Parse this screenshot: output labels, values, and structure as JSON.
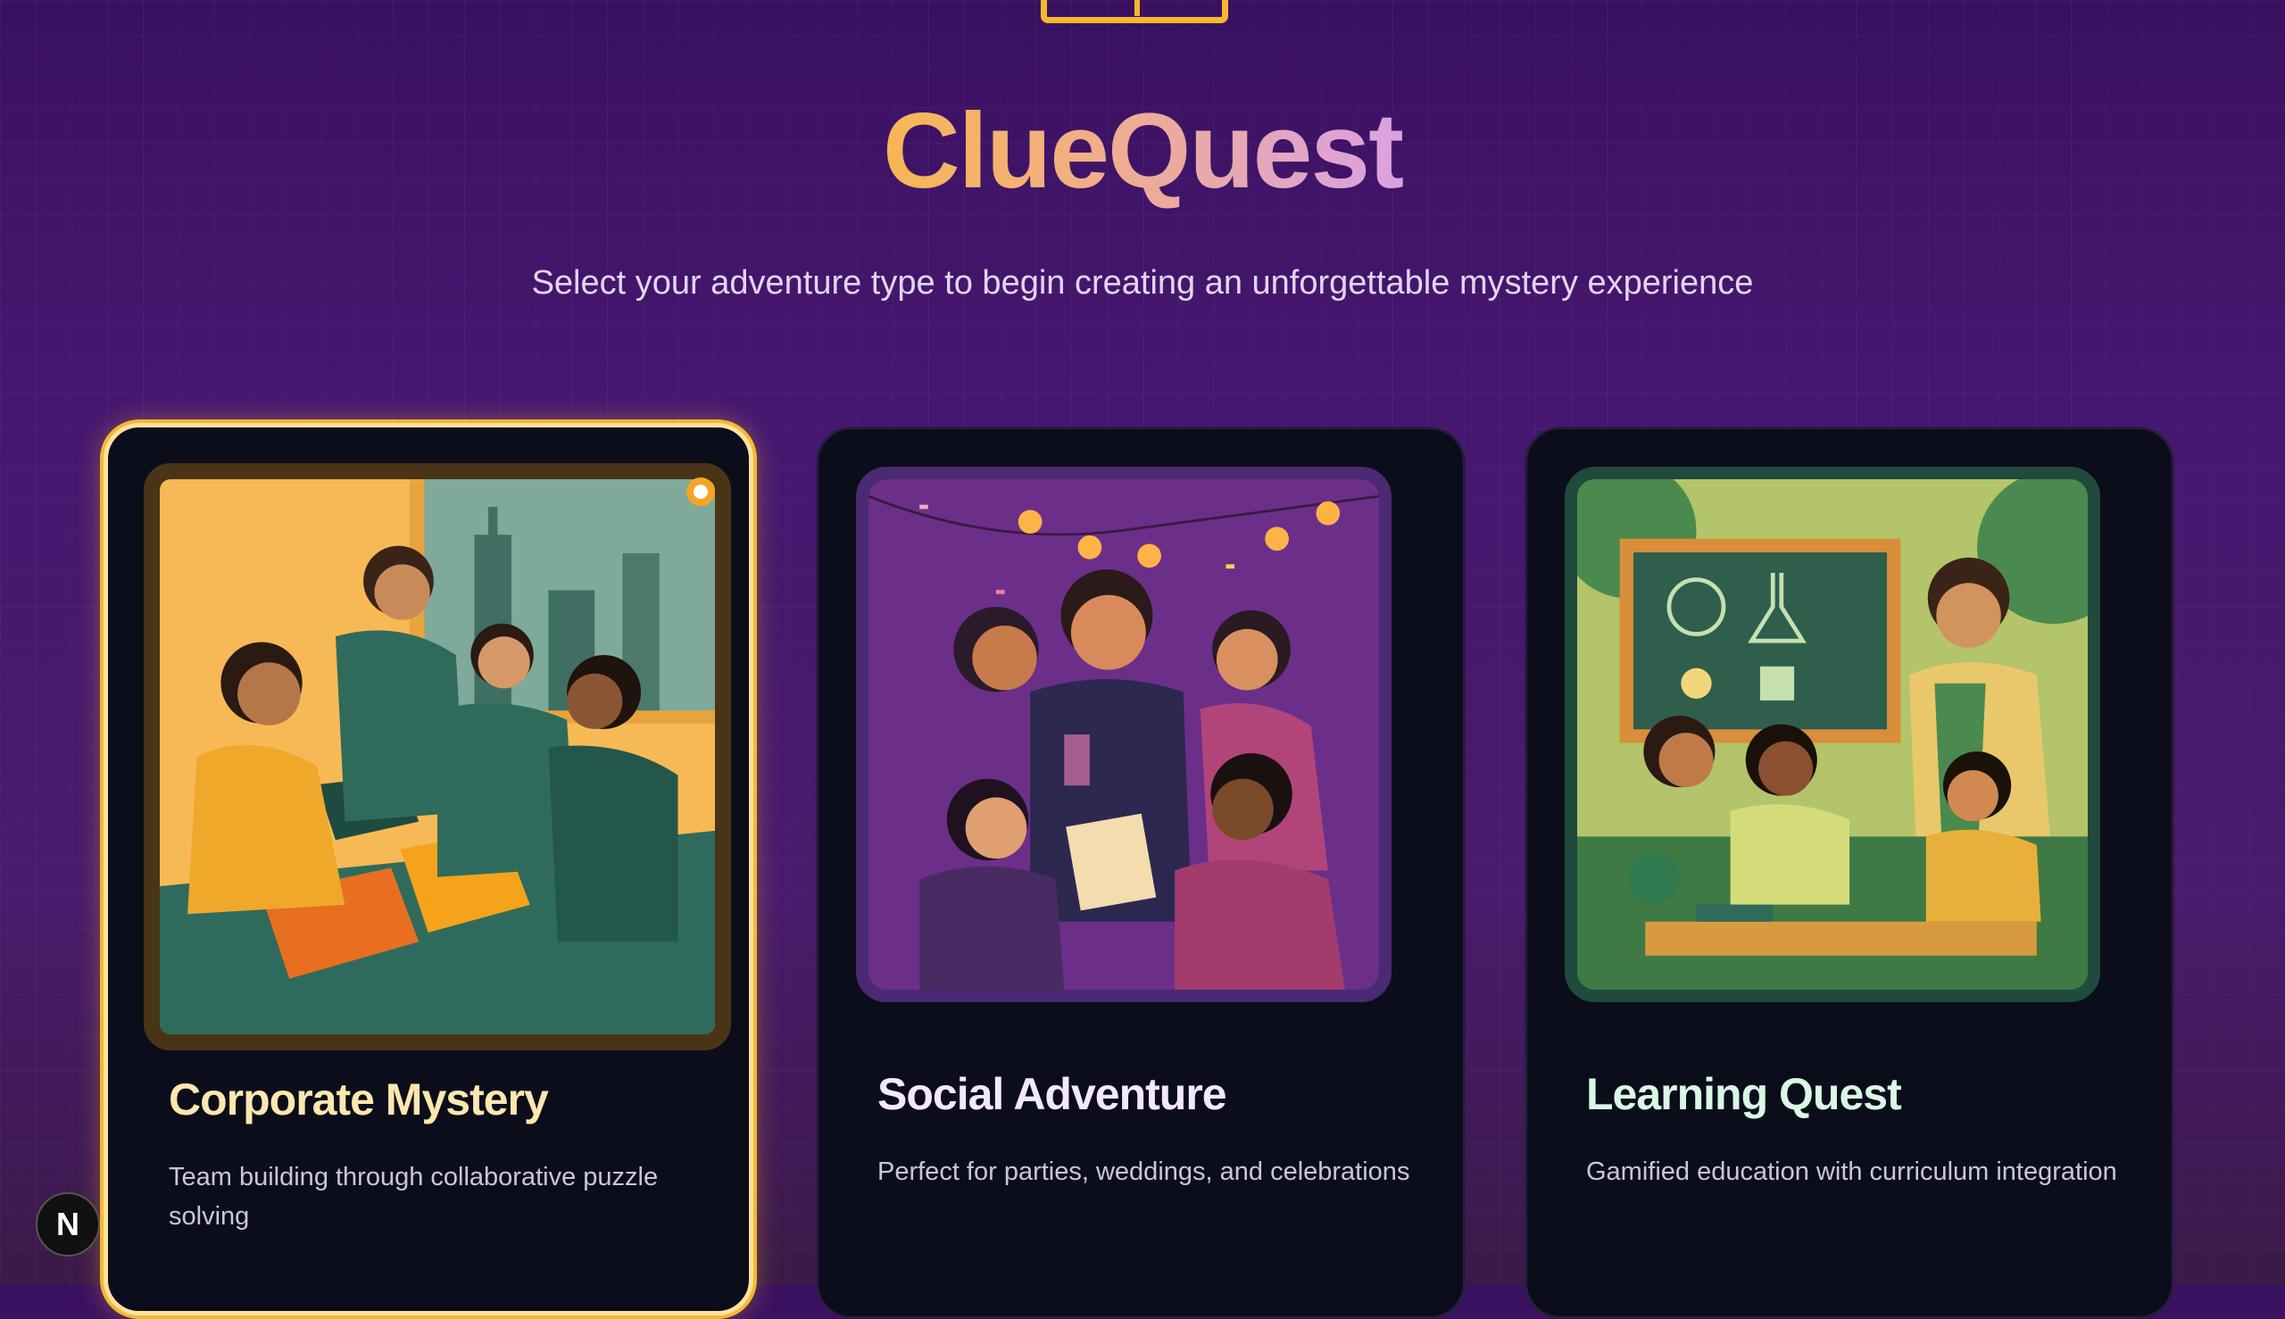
{
  "app": {
    "title": "ClueQuest",
    "subtitle": "Select your adventure type to begin creating an unforgettable mystery experience"
  },
  "cards": [
    {
      "title": "Corporate Mystery",
      "description": "Team building through collaborative puzzle solving",
      "selected": true,
      "title_color": "#fde7b0",
      "illustration": "team-puzzle-illustration"
    },
    {
      "title": "Social Adventure",
      "description": "Perfect for parties, weddings, and celebrations",
      "selected": false,
      "title_color": "#f3e8ff",
      "illustration": "party-illustration"
    },
    {
      "title": "Learning Quest",
      "description": "Gamified education with curriculum integration",
      "selected": false,
      "title_color": "#d9f7e4",
      "illustration": "classroom-illustration"
    }
  ],
  "dev_badge": {
    "label": "N"
  },
  "colors": {
    "accent": "#f5b82e",
    "background": "#461770",
    "card": "#0b0e1a"
  }
}
